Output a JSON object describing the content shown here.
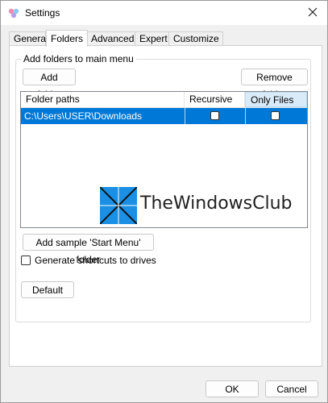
{
  "window": {
    "title": "Settings",
    "close_icon": "close-icon",
    "app_icon": "app-logo-icon"
  },
  "tabs": [
    {
      "label": "General",
      "active": false
    },
    {
      "label": "Folders",
      "active": true
    },
    {
      "label": "Advanced",
      "active": false
    },
    {
      "label": "Expert",
      "active": false
    },
    {
      "label": "Customize",
      "active": false
    }
  ],
  "folders": {
    "group_title": "Add folders to main menu",
    "add_folder": "Add folder",
    "remove_folder": "Remove folder",
    "columns": {
      "path": "Folder paths",
      "recursive": "Recursive",
      "only_files": "Only Files"
    },
    "rows": [
      {
        "path": "C:\\Users\\USER\\Downloads",
        "recursive": false,
        "only_files": false,
        "selected": true
      }
    ],
    "add_sample": "Add sample 'Start Menu' folder",
    "generate_shortcuts_label": "Generate shortcuts to drives",
    "generate_shortcuts_checked": false
  },
  "watermark": {
    "text": "TheWindowsClub"
  },
  "buttons": {
    "default": "Default",
    "ok": "OK",
    "cancel": "Cancel"
  },
  "colors": {
    "selection": "#0078d7",
    "header_hot": "#d9ebf9",
    "watermark_blue": "#1a8fe3"
  }
}
